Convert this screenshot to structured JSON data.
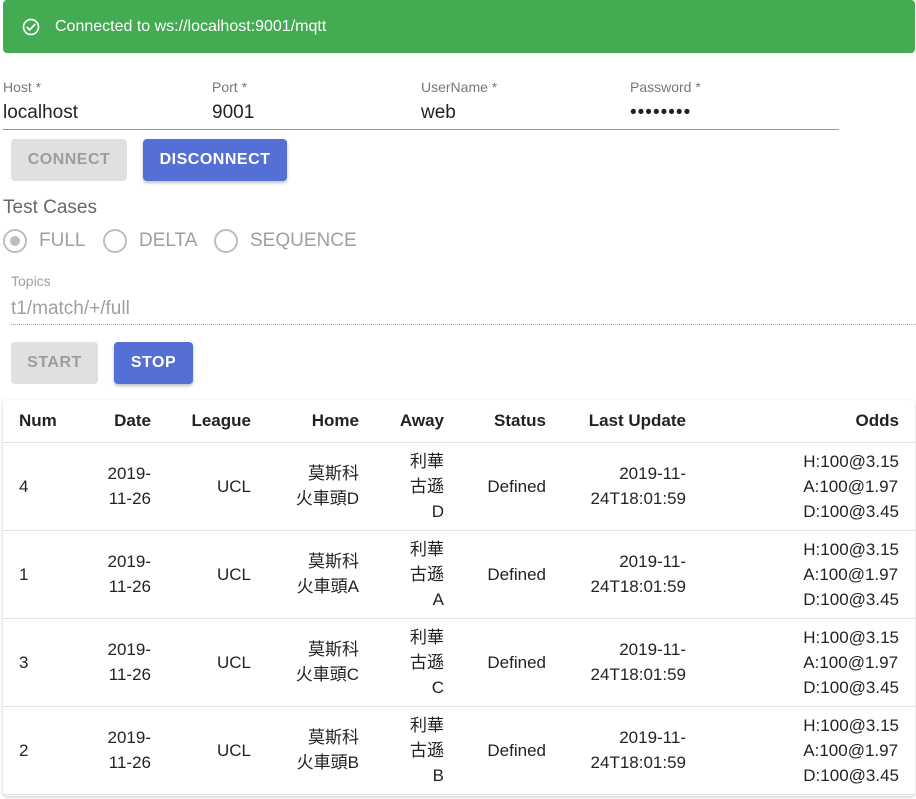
{
  "banner": {
    "text": "Connected to ws://localhost:9001/mqtt",
    "icon": "check-circle-icon",
    "color": "#43ac52"
  },
  "form": {
    "host": {
      "label": "Host *",
      "value": "localhost"
    },
    "port": {
      "label": "Port *",
      "value": "9001"
    },
    "username": {
      "label": "UserName *",
      "value": "web"
    },
    "password": {
      "label": "Password *",
      "value": "••••••••"
    }
  },
  "buttons": {
    "connect": "CONNECT",
    "disconnect": "DISCONNECT",
    "start": "START",
    "stop": "STOP",
    "primary_color": "#5470d6"
  },
  "test_cases": {
    "title": "Test Cases",
    "options": [
      "FULL",
      "DELTA",
      "SEQUENCE"
    ],
    "selected": "FULL"
  },
  "topics": {
    "label": "Topics",
    "value": "t1/match/+/full"
  },
  "table": {
    "headers": [
      "Num",
      "Date",
      "League",
      "Home",
      "Away",
      "Status",
      "Last Update",
      "Odds"
    ],
    "rows": [
      {
        "num": "4",
        "date": "2019-\n11-26",
        "league": "UCL",
        "home": "莫斯科\n火車頭D",
        "away": "利華\n古遜\nD",
        "status": "Defined",
        "last_update": "2019-11-\n24T18:01:59",
        "odds": "H:100@3.15\nA:100@1.97\nD:100@3.45"
      },
      {
        "num": "1",
        "date": "2019-\n11-26",
        "league": "UCL",
        "home": "莫斯科\n火車頭A",
        "away": "利華\n古遜\nA",
        "status": "Defined",
        "last_update": "2019-11-\n24T18:01:59",
        "odds": "H:100@3.15\nA:100@1.97\nD:100@3.45"
      },
      {
        "num": "3",
        "date": "2019-\n11-26",
        "league": "UCL",
        "home": "莫斯科\n火車頭C",
        "away": "利華\n古遜\nC",
        "status": "Defined",
        "last_update": "2019-11-\n24T18:01:59",
        "odds": "H:100@3.15\nA:100@1.97\nD:100@3.45"
      },
      {
        "num": "2",
        "date": "2019-\n11-26",
        "league": "UCL",
        "home": "莫斯科\n火車頭B",
        "away": "利華\n古遜\nB",
        "status": "Defined",
        "last_update": "2019-11-\n24T18:01:59",
        "odds": "H:100@3.15\nA:100@1.97\nD:100@3.45"
      }
    ]
  }
}
